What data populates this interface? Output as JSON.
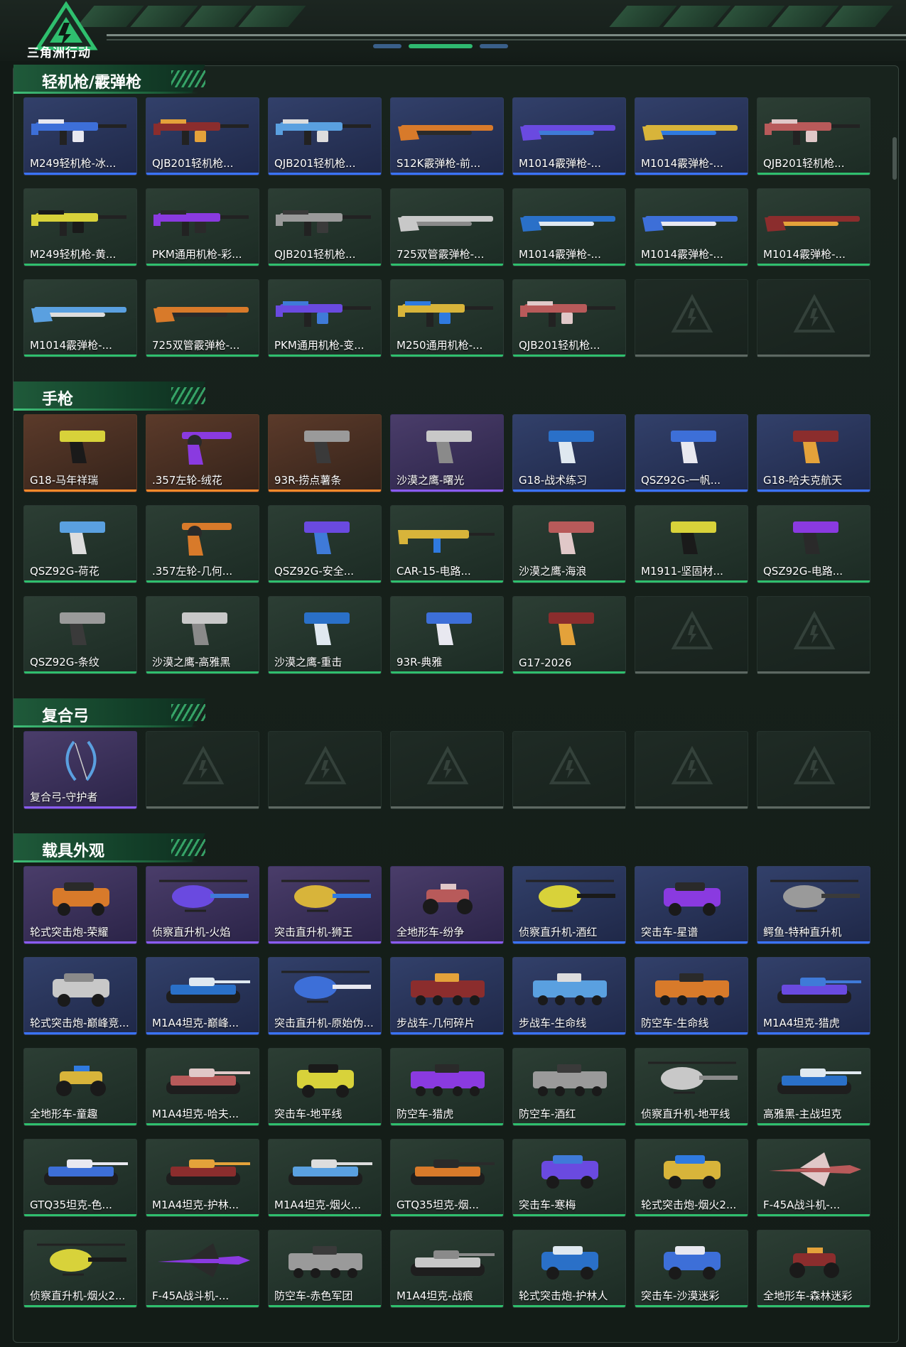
{
  "brand": {
    "logo_text": "三角洲行动",
    "accent": "#2fbf6e"
  },
  "sections": [
    {
      "title": "轻机枪/霰弹枪",
      "items": [
        {
          "label": "M249轻机枪-冰...",
          "rarity": "blue",
          "icon": "machine-gun-icon"
        },
        {
          "label": "QJB201轻机枪...",
          "rarity": "blue",
          "icon": "machine-gun-icon"
        },
        {
          "label": "QJB201轻机枪...",
          "rarity": "blue",
          "icon": "machine-gun-icon"
        },
        {
          "label": "S12K霰弹枪-前...",
          "rarity": "blue",
          "icon": "shotgun-icon"
        },
        {
          "label": "M1014霰弹枪-...",
          "rarity": "blue",
          "icon": "shotgun-icon"
        },
        {
          "label": "M1014霰弹枪-...",
          "rarity": "blue",
          "icon": "shotgun-icon"
        },
        {
          "label": "QJB201轻机枪...",
          "rarity": "green",
          "icon": "machine-gun-icon"
        },
        {
          "label": "M249轻机枪-黄...",
          "rarity": "green",
          "icon": "machine-gun-icon"
        },
        {
          "label": "PKM通用机枪-彩...",
          "rarity": "green",
          "icon": "machine-gun-icon"
        },
        {
          "label": "QJB201轻机枪...",
          "rarity": "green",
          "icon": "machine-gun-icon"
        },
        {
          "label": "725双管霰弹枪-...",
          "rarity": "green",
          "icon": "shotgun-icon"
        },
        {
          "label": "M1014霰弹枪-...",
          "rarity": "green",
          "icon": "shotgun-icon"
        },
        {
          "label": "M1014霰弹枪-...",
          "rarity": "green",
          "icon": "shotgun-icon"
        },
        {
          "label": "M1014霰弹枪-...",
          "rarity": "green",
          "icon": "shotgun-icon"
        },
        {
          "label": "M1014霰弹枪-...",
          "rarity": "green",
          "icon": "shotgun-icon"
        },
        {
          "label": "725双管霰弹枪-...",
          "rarity": "green",
          "icon": "shotgun-icon"
        },
        {
          "label": "PKM通用机枪-变...",
          "rarity": "green",
          "icon": "machine-gun-icon"
        },
        {
          "label": "M250通用机枪-...",
          "rarity": "green",
          "icon": "machine-gun-icon"
        },
        {
          "label": "QJB201轻机枪...",
          "rarity": "green",
          "icon": "machine-gun-icon"
        },
        null,
        null
      ]
    },
    {
      "title": "手枪",
      "items": [
        {
          "label": "G18-马年祥瑞",
          "rarity": "orange",
          "icon": "pistol-icon"
        },
        {
          "label": ".357左轮-绒花",
          "rarity": "orange",
          "icon": "revolver-icon"
        },
        {
          "label": "93R-捞点薯条",
          "rarity": "orange",
          "icon": "pistol-icon"
        },
        {
          "label": "沙漠之鹰-曙光",
          "rarity": "purple",
          "icon": "pistol-icon"
        },
        {
          "label": "G18-战术练习",
          "rarity": "blue",
          "icon": "pistol-icon"
        },
        {
          "label": "QSZ92G-一帆...",
          "rarity": "blue",
          "icon": "pistol-icon"
        },
        {
          "label": "G18-哈夫克航天",
          "rarity": "blue",
          "icon": "pistol-icon"
        },
        {
          "label": "QSZ92G-荷花",
          "rarity": "green",
          "icon": "pistol-icon"
        },
        {
          "label": ".357左轮-几何...",
          "rarity": "green",
          "icon": "revolver-icon"
        },
        {
          "label": "QSZ92G-安全...",
          "rarity": "green",
          "icon": "pistol-icon"
        },
        {
          "label": "CAR-15-电路...",
          "rarity": "green",
          "icon": "rifle-icon"
        },
        {
          "label": "沙漠之鹰-海浪",
          "rarity": "green",
          "icon": "pistol-icon"
        },
        {
          "label": "M1911-坚固材...",
          "rarity": "green",
          "icon": "pistol-icon"
        },
        {
          "label": "QSZ92G-电路...",
          "rarity": "green",
          "icon": "pistol-icon"
        },
        {
          "label": "QSZ92G-条纹",
          "rarity": "green",
          "icon": "pistol-icon"
        },
        {
          "label": "沙漠之鹰-高雅黑",
          "rarity": "green",
          "icon": "pistol-icon"
        },
        {
          "label": "沙漠之鹰-重击",
          "rarity": "green",
          "icon": "pistol-icon"
        },
        {
          "label": "93R-典雅",
          "rarity": "green",
          "icon": "pistol-icon"
        },
        {
          "label": "G17-2026",
          "rarity": "green",
          "icon": "pistol-icon"
        },
        null,
        null
      ]
    },
    {
      "title": "复合弓",
      "items": [
        {
          "label": "复合弓-守护者",
          "rarity": "purple",
          "icon": "bow-icon"
        },
        null,
        null,
        null,
        null,
        null,
        null
      ]
    },
    {
      "title": "载具外观",
      "items": [
        {
          "label": "轮式突击炮-荣耀",
          "rarity": "purple",
          "icon": "armored-car-icon"
        },
        {
          "label": "侦察直升机-火焰",
          "rarity": "purple",
          "icon": "helicopter-icon"
        },
        {
          "label": "突击直升机-狮王",
          "rarity": "purple",
          "icon": "helicopter-icon"
        },
        {
          "label": "全地形车-纷争",
          "rarity": "purple",
          "icon": "atv-icon"
        },
        {
          "label": "侦察直升机-酒红",
          "rarity": "blue",
          "icon": "helicopter-icon"
        },
        {
          "label": "突击车-星谱",
          "rarity": "blue",
          "icon": "armored-car-icon"
        },
        {
          "label": "鳄鱼-特种直升机",
          "rarity": "blue",
          "icon": "helicopter-icon"
        },
        {
          "label": "轮式突击炮-巅峰竞...",
          "rarity": "blue",
          "icon": "armored-car-icon"
        },
        {
          "label": "M1A4坦克-巅峰...",
          "rarity": "blue",
          "icon": "tank-icon"
        },
        {
          "label": "突击直升机-原始伪...",
          "rarity": "blue",
          "icon": "helicopter-icon"
        },
        {
          "label": "步战车-几何碎片",
          "rarity": "blue",
          "icon": "ifv-icon"
        },
        {
          "label": "步战车-生命线",
          "rarity": "blue",
          "icon": "ifv-icon"
        },
        {
          "label": "防空车-生命线",
          "rarity": "blue",
          "icon": "ifv-icon"
        },
        {
          "label": "M1A4坦克-猎虎",
          "rarity": "blue",
          "icon": "tank-icon"
        },
        {
          "label": "全地形车-童趣",
          "rarity": "green",
          "icon": "atv-icon"
        },
        {
          "label": "M1A4坦克-哈夫...",
          "rarity": "green",
          "icon": "tank-icon"
        },
        {
          "label": "突击车-地平线",
          "rarity": "green",
          "icon": "armored-car-icon"
        },
        {
          "label": "防空车-猎虎",
          "rarity": "green",
          "icon": "ifv-icon"
        },
        {
          "label": "防空车-酒红",
          "rarity": "green",
          "icon": "ifv-icon"
        },
        {
          "label": "侦察直升机-地平线",
          "rarity": "green",
          "icon": "helicopter-icon"
        },
        {
          "label": "高雅黑-主战坦克",
          "rarity": "green",
          "icon": "tank-icon"
        },
        {
          "label": "GTQ35坦克-色...",
          "rarity": "green",
          "icon": "tank-icon"
        },
        {
          "label": "M1A4坦克-护林...",
          "rarity": "green",
          "icon": "tank-icon"
        },
        {
          "label": "M1A4坦克-烟火...",
          "rarity": "green",
          "icon": "tank-icon"
        },
        {
          "label": "GTQ35坦克-烟...",
          "rarity": "green",
          "icon": "tank-icon"
        },
        {
          "label": "突击车-寒梅",
          "rarity": "green",
          "icon": "armored-car-icon"
        },
        {
          "label": "轮式突击炮-烟火2...",
          "rarity": "green",
          "icon": "armored-car-icon"
        },
        {
          "label": "F-45A战斗机-...",
          "rarity": "green",
          "icon": "jet-icon"
        },
        {
          "label": "侦察直升机-烟火2...",
          "rarity": "green",
          "icon": "helicopter-icon"
        },
        {
          "label": "F-45A战斗机-...",
          "rarity": "green",
          "icon": "jet-icon"
        },
        {
          "label": "防空车-赤色军团",
          "rarity": "green",
          "icon": "ifv-icon"
        },
        {
          "label": "M1A4坦克-战痕",
          "rarity": "green",
          "icon": "tank-icon"
        },
        {
          "label": "轮式突击炮-护林人",
          "rarity": "green",
          "icon": "armored-car-icon"
        },
        {
          "label": "突击车-沙漠迷彩",
          "rarity": "green",
          "icon": "armored-car-icon"
        },
        {
          "label": "全地形车-森林迷彩",
          "rarity": "green",
          "icon": "atv-icon"
        }
      ]
    }
  ]
}
